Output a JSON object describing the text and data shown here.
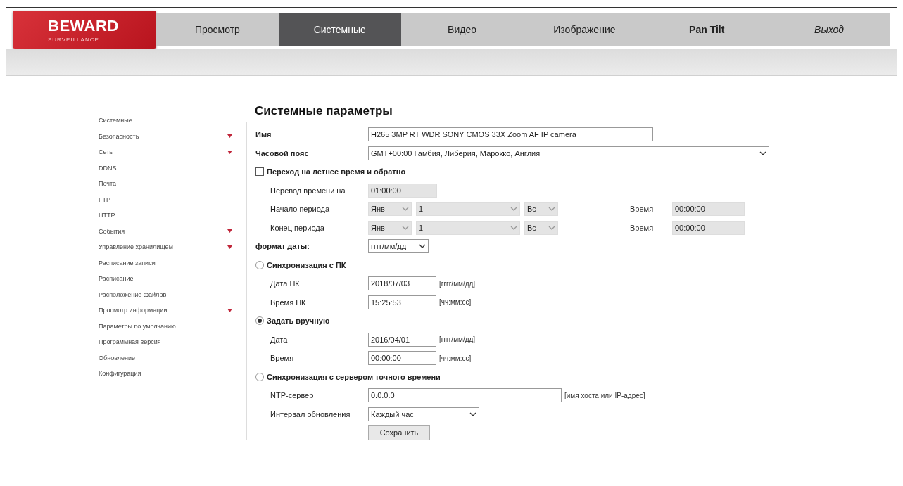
{
  "logo": {
    "brand": "BEWARD",
    "tagline": "SURVEILLANCE"
  },
  "nav": [
    {
      "label": "Просмотр",
      "selected": false,
      "kind": "plain"
    },
    {
      "label": "Системные",
      "selected": true,
      "kind": "plain"
    },
    {
      "label": "Видео",
      "selected": false,
      "kind": "plain"
    },
    {
      "label": "Изображение",
      "selected": false,
      "kind": "plain"
    },
    {
      "label": "Pan Tilt",
      "selected": false,
      "kind": "bold"
    },
    {
      "label": "Выход",
      "selected": false,
      "kind": "italic"
    }
  ],
  "sidebar": {
    "items": [
      {
        "label": "Системные",
        "expandable": false
      },
      {
        "label": "Безопасность",
        "expandable": true
      },
      {
        "label": "Сеть",
        "expandable": true
      },
      {
        "label": "DDNS",
        "expandable": false
      },
      {
        "label": "Почта",
        "expandable": false
      },
      {
        "label": "FTP",
        "expandable": false
      },
      {
        "label": "HTTP",
        "expandable": false
      },
      {
        "label": "События",
        "expandable": true
      },
      {
        "label": "Управление хранилищем",
        "expandable": true
      },
      {
        "label": "Расписание записи",
        "expandable": false
      },
      {
        "label": "Расписание",
        "expandable": false
      },
      {
        "label": "Расположение файлов",
        "expandable": false
      },
      {
        "label": "Просмотр информации",
        "expandable": true
      },
      {
        "label": "Параметры по умолчанию",
        "expandable": false
      },
      {
        "label": "Программная версия",
        "expandable": false
      },
      {
        "label": "Обновление",
        "expandable": false
      },
      {
        "label": "Конфигурация",
        "expandable": false
      }
    ]
  },
  "title": "Системные параметры",
  "name": {
    "label": "Имя",
    "value": "H265 3MP RT WDR SONY CMOS 33X Zoom AF IP camera"
  },
  "timezone": {
    "label": "Часовой пояс",
    "value": "GMT+00:00 Гамбия, Либерия, Марокко, Англия"
  },
  "dst": {
    "label": "Переход на летнее время и обратно",
    "checked": false
  },
  "shift": {
    "label": "Перевод времени на",
    "value": "01:00:00",
    "disabled": true
  },
  "periods": [
    {
      "label": "Начало периода",
      "month": "Янв",
      "day": "1",
      "weekday": "Вс",
      "time_label": "Время",
      "time": "00:00:00",
      "disabled": true
    },
    {
      "label": "Конец периода",
      "month": "Янв",
      "day": "1",
      "weekday": "Вс",
      "time_label": "Время",
      "time": "00:00:00",
      "disabled": true
    }
  ],
  "date_format": {
    "label": "формат даты:",
    "value": "гггг/мм/дд"
  },
  "modes": [
    {
      "label": "Синхронизация с ПК",
      "selected": false,
      "fields": [
        {
          "kind": "input",
          "label": "Дата ПК",
          "value": "2018/07/03",
          "hint": "[гггг/мм/дд]"
        },
        {
          "kind": "input",
          "label": "Время ПК",
          "value": "15:25:53",
          "hint": "[чч:мм:сс]"
        }
      ]
    },
    {
      "label": "Задать вручную",
      "selected": true,
      "fields": [
        {
          "kind": "input",
          "label": "Дата",
          "value": "2016/04/01",
          "hint": "[гггг/мм/дд]"
        },
        {
          "kind": "input",
          "label": "Время",
          "value": "00:00:00",
          "hint": "[чч:мм:сс]"
        }
      ]
    },
    {
      "label": "Синхронизация с сервером точного времени",
      "selected": false,
      "fields": [
        {
          "kind": "wide",
          "label": "NTP-сервер",
          "value": "0.0.0.0",
          "hint": "[имя хоста или IP-адрес]"
        },
        {
          "kind": "select",
          "label": "Интервал обновления",
          "value": "Каждый час"
        }
      ]
    }
  ],
  "save": "Сохранить"
}
